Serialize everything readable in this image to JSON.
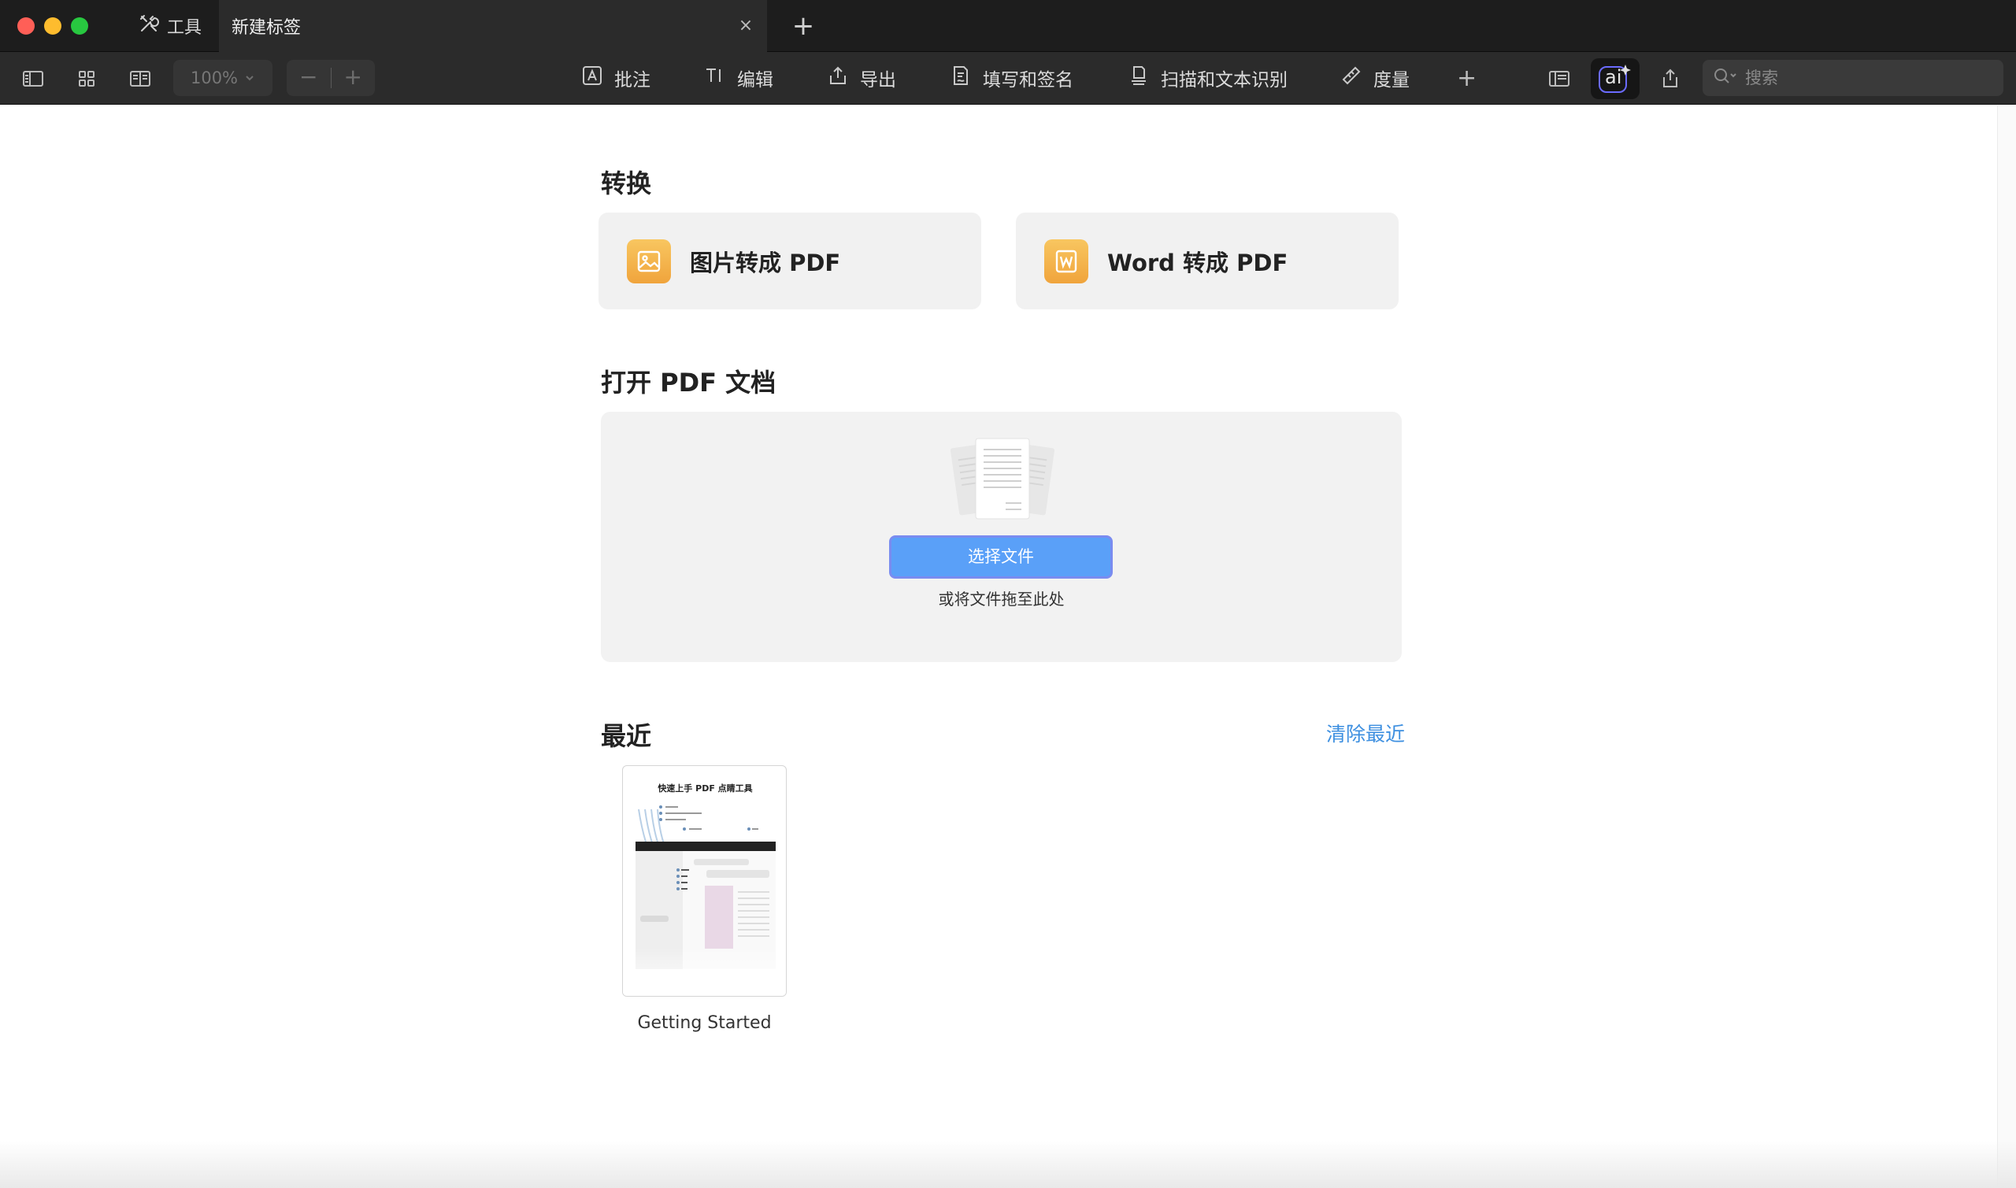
{
  "titlebar": {
    "tools_tab_label": "工具",
    "active_tab_label": "新建标签",
    "close_glyph": "×",
    "new_tab_glyph": "+"
  },
  "toolbar": {
    "zoom_level": "100%",
    "zoom_out_glyph": "−",
    "zoom_in_glyph": "+",
    "menu": {
      "annotate": "批注",
      "edit": "编辑",
      "export": "导出",
      "fill_sign": "填写和签名",
      "scan_ocr": "扫描和文本识别",
      "measure": "度量"
    },
    "add_glyph": "+",
    "ai_label": "ai",
    "search_placeholder": "搜索"
  },
  "convert": {
    "title": "转换",
    "image_to_pdf": "图片转成 PDF",
    "word_to_pdf": "Word 转成 PDF"
  },
  "open_pdf": {
    "title": "打开 PDF 文档",
    "choose_button": "选择文件",
    "drop_hint": "或将文件拖至此处"
  },
  "recent": {
    "title": "最近",
    "clear_button": "清除最近",
    "items": [
      {
        "thumb_title": "快速上手 PDF 点睛工具",
        "name": "Getting Started"
      }
    ]
  },
  "colors": {
    "accent_blue": "#5aa0f8",
    "link_blue": "#3d8fe0",
    "convert_icon_orange": "#f0a43c"
  }
}
